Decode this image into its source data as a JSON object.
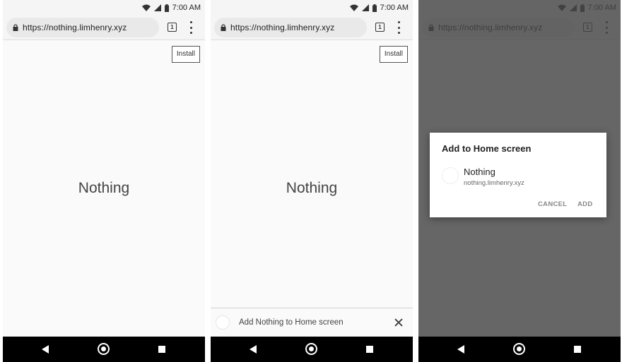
{
  "status_bar": {
    "time": "7:00 AM"
  },
  "browser": {
    "url": "https://nothing.limhenry.xyz",
    "tab_count": "1"
  },
  "page": {
    "install_label": "Install",
    "title": "Nothing"
  },
  "banner": {
    "text": "Add Nothing to Home screen"
  },
  "dialog": {
    "title": "Add to Home screen",
    "app_name": "Nothing",
    "app_url": "nothing.limhenry.xyz",
    "cancel_label": "CANCEL",
    "add_label": "ADD"
  },
  "icons": [
    "wifi-icon",
    "signal-icon",
    "battery-icon",
    "lock-icon",
    "tab-switcher-icon",
    "overflow-menu-icon",
    "back-icon",
    "home-icon",
    "recents-icon",
    "close-icon",
    "app-icon"
  ]
}
